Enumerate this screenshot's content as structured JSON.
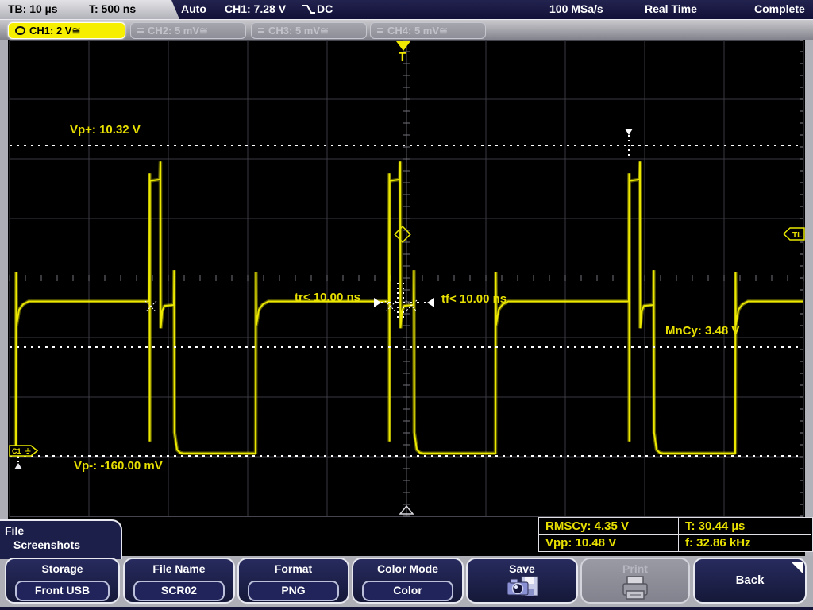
{
  "statusbar": {
    "timebase": "TB: 10 µs",
    "trigger_time": "T: 500 ns",
    "trigger_mode": "Auto",
    "trigger_setting": "CH1: 7.28 V",
    "trigger_coupling": "DC",
    "sample_rate": "100 MSa/s",
    "acquisition_mode": "Real Time",
    "acquisition_status": "Complete"
  },
  "channel_tabs": [
    {
      "label": "CH1: 2 V≅",
      "active": true
    },
    {
      "label": "CH2: 5 mV≅",
      "active": false
    },
    {
      "label": "CH3: 5 mV≅",
      "active": false
    },
    {
      "label": "CH4: 5 mV≅",
      "active": false
    }
  ],
  "display": {
    "trigger_marker": "T",
    "trigger_level_marker": "TL",
    "channel_marker": "C1",
    "annotations": {
      "vp_plus": "Vp+: 10.32 V",
      "vp_minus": "Vp-: -160.00 mV",
      "mean_cycle": "MnCy: 3.48 V",
      "rise_time": "tr< 10.00 ns",
      "fall_time": "tf< 10.00 ns"
    }
  },
  "measurements": {
    "rows": [
      [
        "RMSCy: 4.35 V",
        "T: 30.44 µs"
      ],
      [
        "Vpp: 10.48 V",
        "f: 32.86 kHz"
      ]
    ]
  },
  "menu": {
    "title_line1": "File",
    "title_line2": "Screenshots",
    "buttons": [
      {
        "label": "Storage",
        "value": "Front USB"
      },
      {
        "label": "File Name",
        "value": "SCR02"
      },
      {
        "label": "Format",
        "value": "PNG"
      },
      {
        "label": "Color Mode",
        "value": "Color"
      },
      {
        "label": "Save",
        "icon": "camera-floppy-icon"
      },
      {
        "label": "Print",
        "icon": "printer-icon",
        "disabled": true
      },
      {
        "label": "Back",
        "icon": "submenu-corner-icon"
      }
    ]
  },
  "colors": {
    "trace_yellow": "#ece800",
    "annotation_yellow": "#e8e000",
    "tab_active_yellow": "#f6ef00",
    "panel_navy": "#1c1f4a",
    "statusbar_navy": "#16163f",
    "screen_black": "#000000",
    "chrome_gray": "#aeaeb6",
    "measure_line_white": "#ffffff"
  },
  "chart_data": {
    "type": "line",
    "title": "CH1 square wave with pre-fall overshoot pulse",
    "x_units": "µs",
    "y_units": "V",
    "timebase_us_per_div": 10,
    "ch1_volts_per_div": 2,
    "grid_divs": {
      "horizontal": 10,
      "vertical": 8
    },
    "trigger": {
      "source": "CH1",
      "level_v": 7.28,
      "slope": "falling",
      "coupling": "DC"
    },
    "measurements": {
      "vp_plus_v": 10.32,
      "vp_minus_mv": -160.0,
      "mean_cycle_v": 3.48,
      "rms_cycle_v": 4.35,
      "vpp_v": 10.48,
      "period_us": 30.44,
      "frequency_khz": 32.86,
      "rise_time_ns_less_than": 10.0,
      "fall_time_ns_less_than": 10.0
    },
    "waveform": {
      "period_us": 30.2,
      "period_starts_us": [
        0.8,
        31.0,
        61.2,
        91.4
      ],
      "pre_level_v": -0.1,
      "period_shape_t_v": [
        [
          0.0,
          -0.1
        ],
        [
          0.04,
          6.0
        ],
        [
          0.08,
          4.2
        ],
        [
          0.4,
          4.72
        ],
        [
          0.9,
          4.9
        ],
        [
          1.6,
          5.0
        ],
        [
          16.8,
          5.0
        ],
        [
          16.84,
          9.3
        ],
        [
          16.86,
          0.3
        ],
        [
          16.88,
          9.05
        ],
        [
          18.15,
          9.1
        ],
        [
          18.2,
          9.7
        ],
        [
          18.24,
          4.1
        ],
        [
          18.45,
          4.7
        ],
        [
          18.7,
          4.85
        ],
        [
          19.9,
          4.88
        ],
        [
          19.94,
          6.05
        ],
        [
          19.98,
          0.6
        ],
        [
          20.3,
          0.02
        ],
        [
          20.7,
          -0.08
        ],
        [
          21.2,
          -0.1
        ],
        [
          30.2,
          -0.1
        ]
      ]
    },
    "reference_lines_v": {
      "vp_plus": 10.24,
      "mean_cycle": 3.47,
      "vp_minus": -0.16
    }
  }
}
